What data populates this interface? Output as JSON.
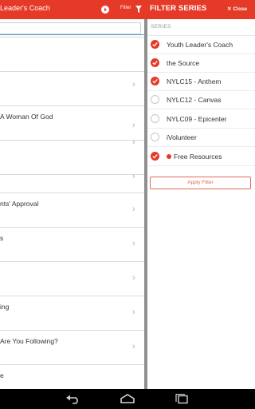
{
  "topbar": {
    "title": "Leader's Coach",
    "filter_label": "Filter",
    "panel_title": "FILTER SERIES",
    "close_label": "Close"
  },
  "list": {
    "rows": [
      {
        "text": ""
      },
      {
        "text": ""
      },
      {
        "text": "A Woman Of God"
      },
      {
        "text": ""
      },
      {
        "text": ""
      },
      {
        "text": "nts' Approval"
      },
      {
        "text": "s"
      },
      {
        "text": ""
      },
      {
        "text": "ing"
      },
      {
        "text": "Are You Following?"
      },
      {
        "text": "e"
      }
    ]
  },
  "filter": {
    "header": "SERIES",
    "options": [
      {
        "label": "Youth Leader's Coach",
        "checked": true
      },
      {
        "label": "the Source",
        "checked": true
      },
      {
        "label": "NYLC15 - Anthem",
        "checked": true
      },
      {
        "label": "NYLC12 - Canvas",
        "checked": false
      },
      {
        "label": "NYLC09 - Epicenter",
        "checked": false
      },
      {
        "label": "iVolunteer",
        "checked": false
      },
      {
        "label": "Free Resources",
        "checked": true
      }
    ],
    "apply_label": "Apply Filter"
  },
  "colors": {
    "accent": "#e53a27",
    "navbar": "#000000"
  },
  "icons": [
    "play-icon",
    "funnel-icon",
    "close-icon",
    "chevron-right-icon",
    "check-icon",
    "back-icon",
    "home-icon",
    "recents-icon"
  ]
}
